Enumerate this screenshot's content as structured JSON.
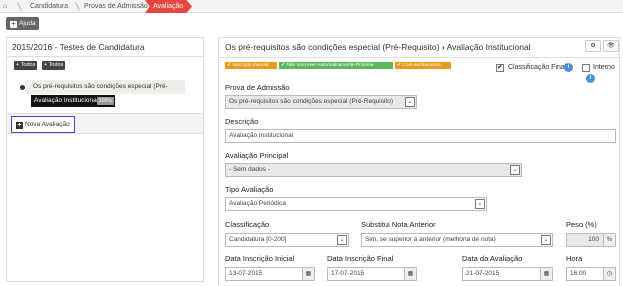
{
  "breadcrumb": {
    "home_icon": "home-icon",
    "items": [
      "Candidatura",
      "Provas de Admissão",
      "Avaliação"
    ]
  },
  "help_label": "Ajuda",
  "left": {
    "title": "2015/2016 - Testes de Candidatura",
    "tags": [
      "Todos",
      "Todos"
    ],
    "tree_item": "Os pré-requisitos são condições especial (Pré-Requisito)",
    "leaf_label": "Avaliação Institucional",
    "leaf_badge": "100%",
    "new_button": "Nova Avaliação"
  },
  "right": {
    "title_part1": "Os pré-requisitos são condições especial (Pré-Requisito)",
    "title_sep": "›",
    "title_part2": "Avaliação Institucional",
    "labels": [
      "Inscrição manual",
      "Não Inscrever Automaticamente Próxima Avaliação",
      "Com enrolamento"
    ],
    "classificacao_final": "Classificação Final",
    "interno": "Interno",
    "prova_label": "Prova de Admissão",
    "prova_value": "Os pré-requisitos são condições especial (Pré-Requisito)",
    "descricao_label": "Descrição",
    "descricao_value": "Avaliação Institucional",
    "principal_label": "Avaliação Principal",
    "principal_value": "- Sem dados -",
    "tipo_label": "Tipo Avaliação",
    "tipo_value": "Avaliação Periódica",
    "classificacao_label": "Classificação",
    "classificacao_value": "Candidatura [0-200]",
    "substitui_label": "Substitui Nota Anterior",
    "substitui_value": "Sim, se superior à anterior (melhoria de nota)",
    "peso_label": "Peso (%)",
    "peso_value": "100",
    "peso_unit": "%",
    "data_ini_label": "Data Inscrição Inicial",
    "data_ini_value": "13-07-2015",
    "data_fim_label": "Data Inscrição Final",
    "data_fim_value": "17-07-2015",
    "data_aval_label": "Data da Avaliação",
    "data_aval_value": "21-07-2015",
    "hora_label": "Hora",
    "hora_value": "16:00"
  }
}
